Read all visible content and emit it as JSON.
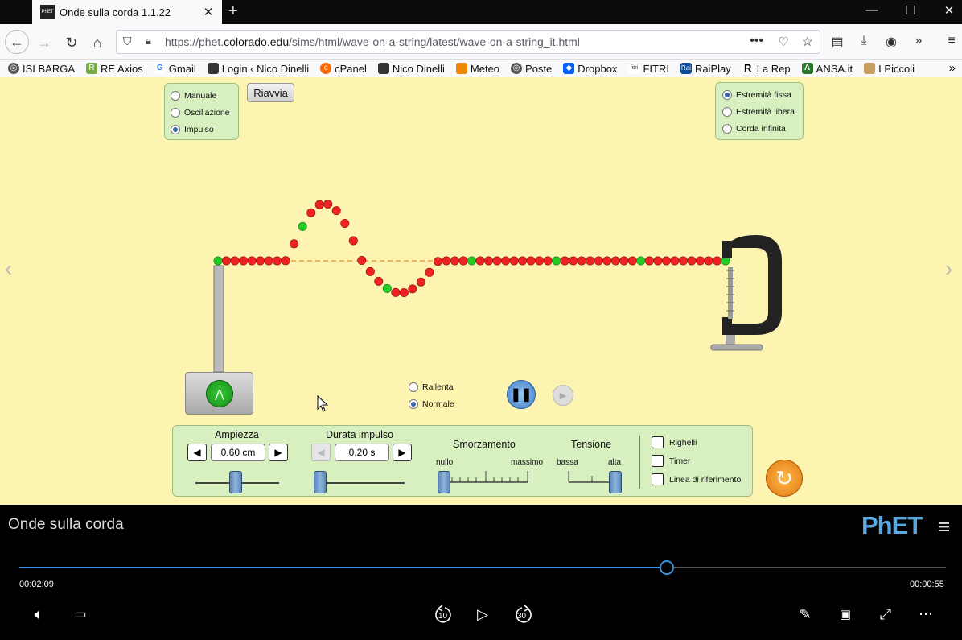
{
  "browser": {
    "tab_title": "Onde sulla corda 1.1.22",
    "url_prefix": "https://phet.",
    "url_domain": "colorado.edu",
    "url_rest": "/sims/html/wave-on-a-string/latest/wave-on-a-string_it.html",
    "bookmarks": [
      "ISI BARGA",
      "RE Axios",
      "Gmail",
      "Login ‹ Nico Dinelli",
      "cPanel",
      "Nico Dinelli",
      "Meteo",
      "Poste",
      "Dropbox",
      "FITRI",
      "RaiPlay",
      "La Rep",
      "ANSA.it",
      "I Piccoli"
    ]
  },
  "sim": {
    "mode_options": [
      {
        "label": "Manuale",
        "selected": false
      },
      {
        "label": "Oscillazione",
        "selected": false
      },
      {
        "label": "Impulso",
        "selected": true
      }
    ],
    "restart_label": "Riavvia",
    "end_options": [
      {
        "label": "Estremità fissa",
        "selected": true
      },
      {
        "label": "Estremità libera",
        "selected": false
      },
      {
        "label": "Corda infinita",
        "selected": false
      }
    ],
    "speed_options": [
      {
        "label": "Rallenta",
        "selected": false
      },
      {
        "label": "Normale",
        "selected": true
      }
    ],
    "controls": {
      "amplitude_label": "Ampiezza",
      "amplitude_value": "0.60 cm",
      "pulse_label": "Durata impulso",
      "pulse_value": "0.20 s",
      "damping_label": "Smorzamento",
      "damping_min": "nullo",
      "damping_max": "massimo",
      "tension_label": "Tensione",
      "tension_min": "bassa",
      "tension_max": "alta"
    },
    "checkboxes": [
      "Righelli",
      "Timer",
      "Linea di riferimento"
    ]
  },
  "player": {
    "title": "Onde sulla corda",
    "logo": "PhET",
    "elapsed": "00:02:09",
    "remaining": "00:00:55",
    "progress": 0.699,
    "skip_back": "10",
    "skip_forward": "30"
  }
}
